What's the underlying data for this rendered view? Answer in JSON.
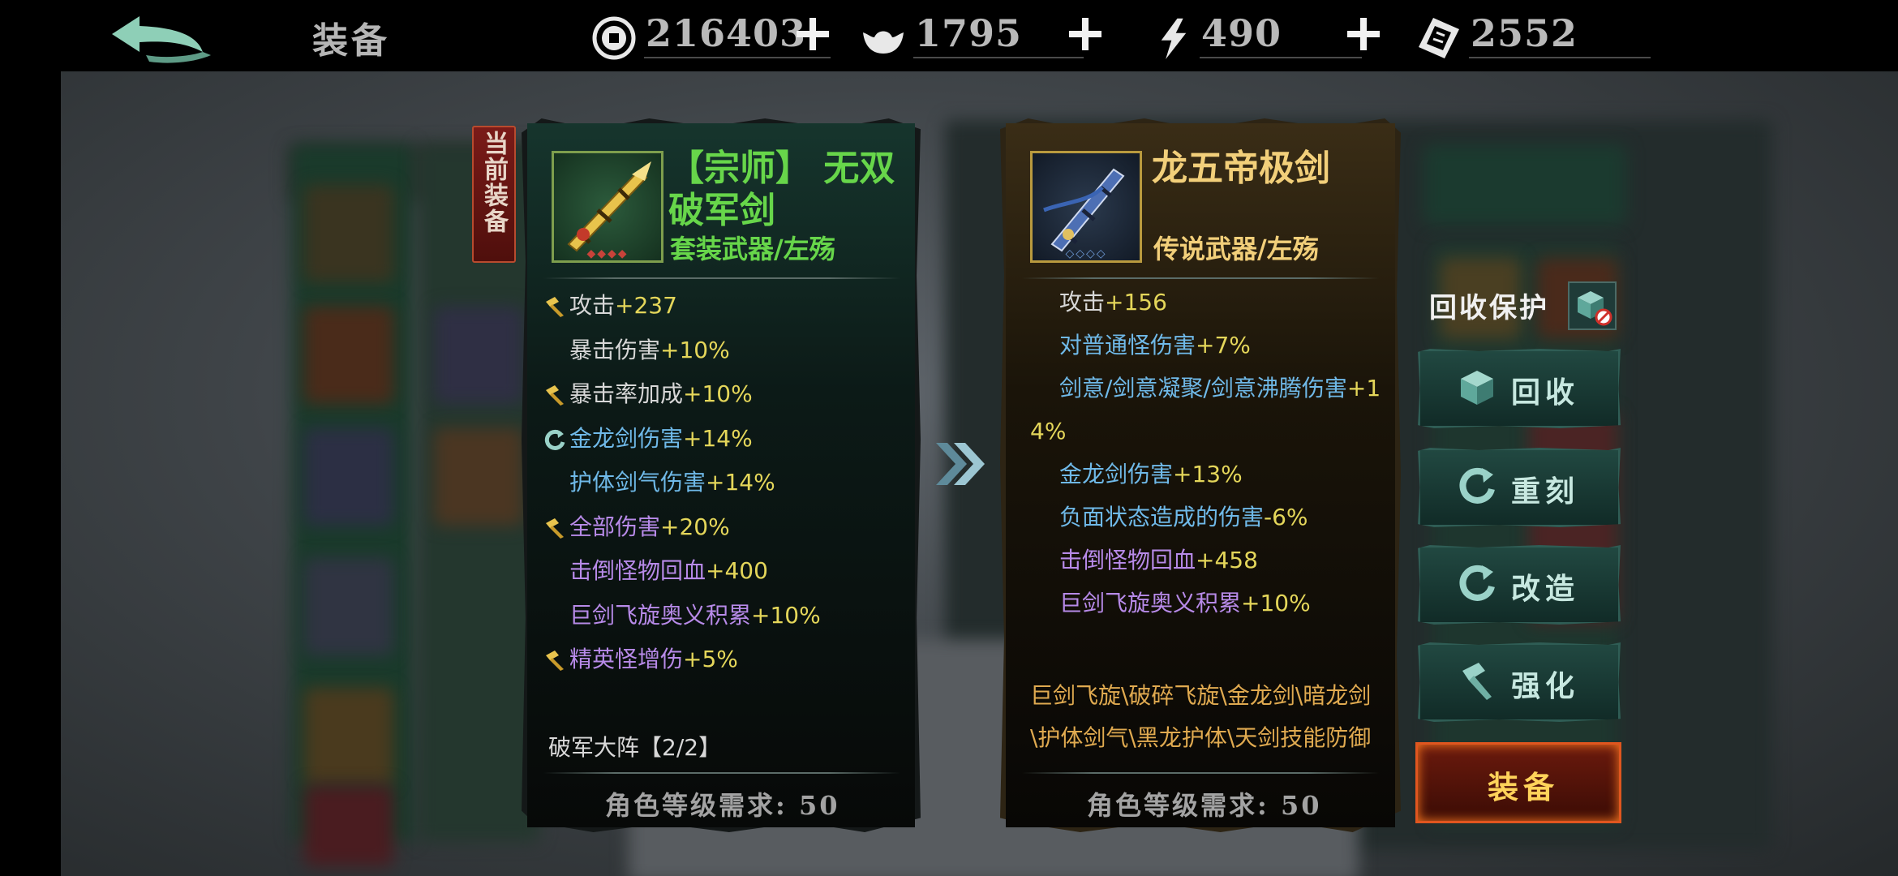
{
  "header": {
    "title": "装备",
    "currencies": [
      {
        "icon": "coin-icon",
        "value": "216403"
      },
      {
        "icon": "ingot-icon",
        "value": "1795"
      },
      {
        "icon": "lightning-icon",
        "value": "490"
      },
      {
        "icon": "ticket-icon",
        "value": "2552"
      }
    ]
  },
  "current_tag": "当前装备",
  "current_item": {
    "name_line1": "【宗师】 无双",
    "name_line2": "破军剑",
    "type": "套装武器/左殇",
    "stats": [
      {
        "label": "攻击",
        "value": "+237",
        "icon": "hammer-icon",
        "color": "#d7d7d7"
      },
      {
        "label": "暴击伤害",
        "value": "+10%",
        "icon": "",
        "color": "#d7d7d7"
      },
      {
        "label": "暴击率加成",
        "value": "+10%",
        "icon": "hammer-icon",
        "color": "#d7d7d7"
      },
      {
        "label": "金龙剑伤害",
        "value": "+14%",
        "icon": "reforge-icon",
        "color": "#6fb9e8"
      },
      {
        "label": "护体剑气伤害",
        "value": "+14%",
        "icon": "",
        "color": "#6fb9e8"
      },
      {
        "label": "全部伤害",
        "value": "+20%",
        "icon": "hammer-icon",
        "color": "#b78ae8"
      },
      {
        "label": "击倒怪物回血",
        "value": "+400",
        "icon": "",
        "color": "#b78ae8"
      },
      {
        "label": "巨剑飞旋奥义积累",
        "value": "+10%",
        "icon": "",
        "color": "#b78ae8"
      },
      {
        "label": "精英怪增伤",
        "value": "+5%",
        "icon": "hammer-icon",
        "color": "#b78ae8"
      }
    ],
    "set_bonus": "破军大阵【2/2】",
    "requirement": "角色等级需求: 50"
  },
  "new_item": {
    "name": "龙五帝极剑",
    "type": "传说武器/左殇",
    "stats": [
      {
        "label": "攻击",
        "value": "+156",
        "color": "#d7d7d7"
      },
      {
        "label": "对普通怪伤害",
        "value": "+7%",
        "color": "#6fb9e8"
      },
      {
        "label": "剑意/剑意凝聚/剑意沸腾伤害",
        "value": "+1",
        "color": "#6fb9e8"
      },
      {
        "label": "",
        "value": "4%",
        "color": "#6fb9e8"
      },
      {
        "label": "金龙剑伤害",
        "value": "+13%",
        "color": "#6fb9e8"
      },
      {
        "label": "负面状态造成的伤害",
        "value": "-6%",
        "color": "#6fb9e8"
      },
      {
        "label": "击倒怪物回血",
        "value": "+458",
        "color": "#b78ae8"
      },
      {
        "label": "巨剑飞旋奥义积累",
        "value": "+10%",
        "color": "#b78ae8"
      }
    ],
    "description_lines": [
      "巨剑飞旋\\破碎飞旋\\金龙剑\\暗龙剑",
      "\\护体剑气\\黑龙护体\\天剑技能防御"
    ],
    "requirement": "角色等级需求: 50"
  },
  "actions": {
    "protect_label": "回收保护",
    "recycle": "回收",
    "reengrave": "重刻",
    "modify": "改造",
    "enhance": "强化",
    "equip": "装备"
  },
  "colors": {
    "green_name": "#67d64a",
    "gold_name": "#f2cf7a",
    "value_yellow": "#e4d65a",
    "accent_teal": "#2f5d55",
    "equip_orange": "#e0561f"
  }
}
